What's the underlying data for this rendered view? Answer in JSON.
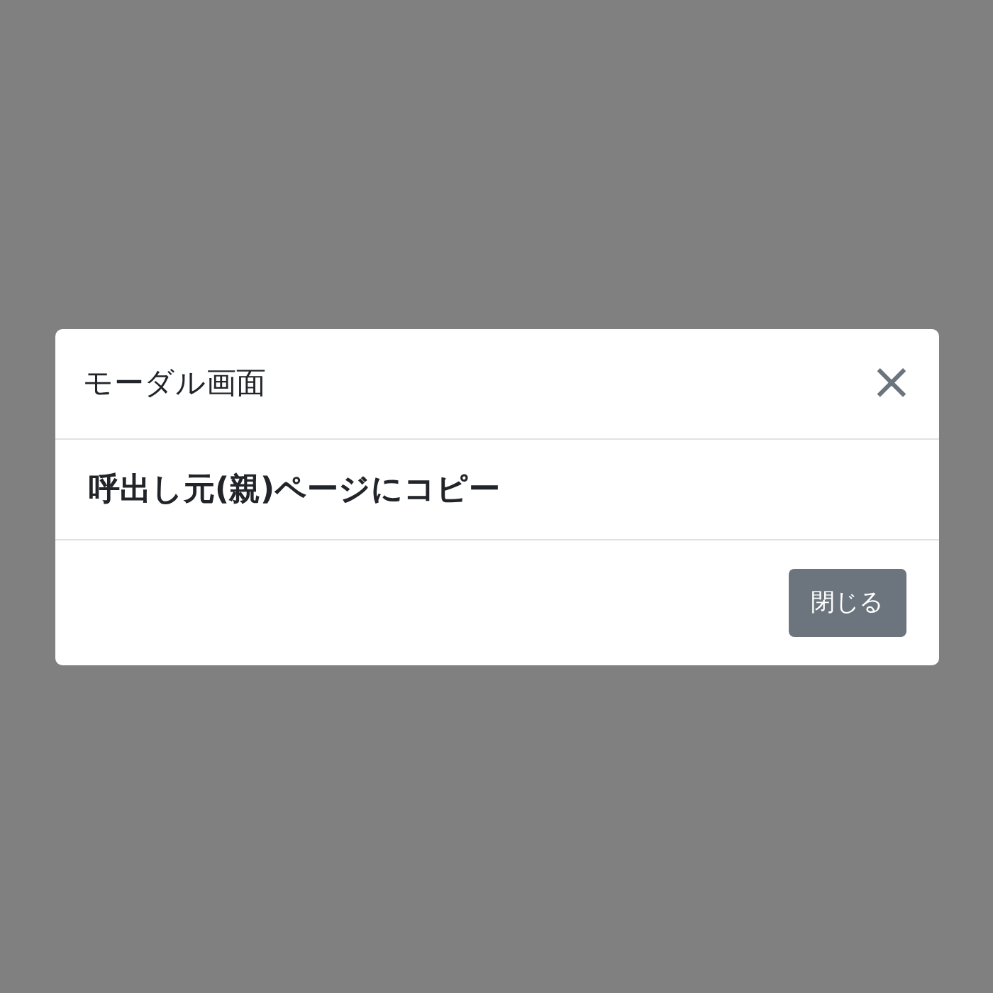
{
  "modal": {
    "title": "モーダル画面",
    "close_icon": "×",
    "body_text": "呼出し元(親)ページにコピー",
    "buttons": [
      "閉じる"
    ]
  }
}
